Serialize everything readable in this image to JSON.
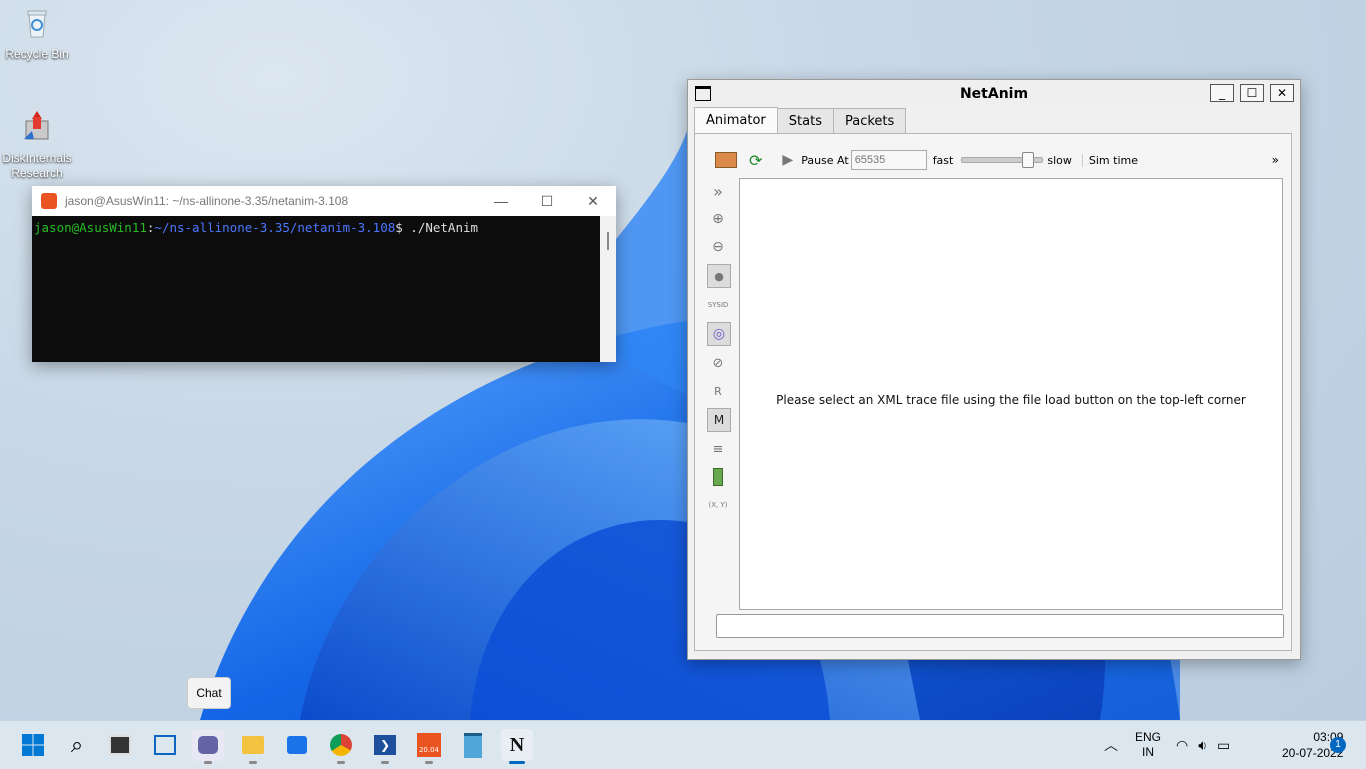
{
  "desktop": {
    "icons": [
      {
        "label": "Recycle Bin"
      },
      {
        "label": "DiskInternals\nResearch"
      }
    ]
  },
  "terminal": {
    "title": "jason@AsusWin11: ~/ns-allinone-3.35/netanim-3.108",
    "prompt_user": "jason@AsusWin11",
    "prompt_sep": ":",
    "prompt_path": "~/ns-allinone-3.35/netanim-3.108",
    "prompt_symbol": "$",
    "command": " ./NetAnim",
    "colors": {
      "user": "#25bc24",
      "path": "#4c77ff",
      "bg": "#0c0c0c"
    }
  },
  "netanim": {
    "title": "NetAnim",
    "tabs": [
      {
        "label": "Animator",
        "active": true
      },
      {
        "label": "Stats",
        "active": false
      },
      {
        "label": "Packets",
        "active": false
      }
    ],
    "toolbar": {
      "pause_at_label": "Pause At",
      "pause_at_placeholder": "65535",
      "fast_label": "fast",
      "slow_label": "slow",
      "sim_time_label": "Sim time",
      "more_label": "»"
    },
    "sidebar": {
      "sysid_label": "SYSID",
      "r_label": "R",
      "m_label": "M",
      "xy_label": "(X, Y)"
    },
    "canvas_message": "Please select an XML trace file using the file load button on the top-left corner"
  },
  "chat_tooltip": "Chat",
  "tray": {
    "lang_top": "ENG",
    "lang_bottom": "IN",
    "time": "03:09",
    "date": "20-07-2022",
    "notification_count": "1"
  },
  "taskbar": {
    "icons": [
      "windows-start-icon",
      "search-icon",
      "task-view-icon",
      "widgets-icon",
      "chat-teams-icon",
      "file-explorer-icon",
      "store-icon",
      "chrome-icon",
      "powershell-icon",
      "ubuntu-icon",
      "notepad-icon",
      "netanim-icon"
    ],
    "ubuntu_badge": "20.04"
  }
}
